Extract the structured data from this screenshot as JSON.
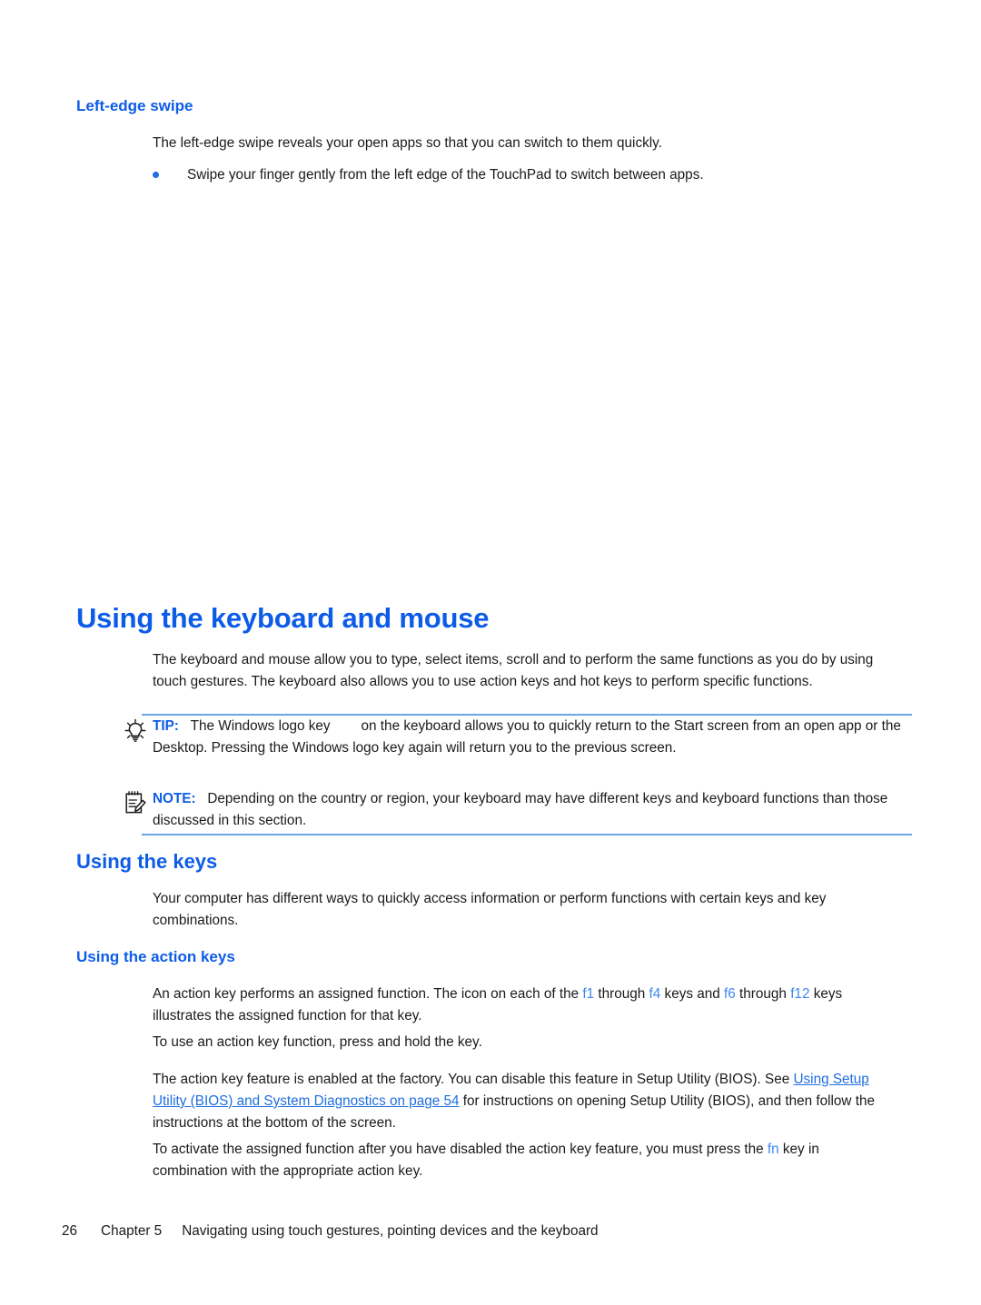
{
  "document": {
    "section_heading": "Left-edge swipe",
    "left_edge_swipe": {
      "intro": "The left-edge swipe reveals your open apps so that you can switch to them quickly.",
      "bullet": "Swipe your finger gently from the left edge of the TouchPad to switch between apps."
    },
    "keyboard_mouse": {
      "title": "Using the keyboard and mouse",
      "intro": "The keyboard and mouse allow you to type, select items, scroll and to perform the same functions as you do by using touch gestures. The keyboard also allows you to use action keys and hot keys to perform specific functions.",
      "tip": {
        "label": "TIP:",
        "icon": "lightbulb-icon",
        "text_before_key": "The Windows logo key",
        "text_after_key": "on the keyboard allows you to quickly return to the Start screen from an open app or the Desktop. Pressing the Windows logo key again will return you to the previous screen."
      },
      "note": {
        "label": "NOTE:",
        "icon": "notepad-pencil-icon",
        "text": "Depending on the country or region, your keyboard may have different keys and keyboard functions than those discussed in this section."
      }
    },
    "using_the_keys": {
      "title": "Using the keys",
      "intro": "Your computer has different ways to quickly access information or perform functions with certain keys and key combinations."
    },
    "action_keys": {
      "title": "Using the action keys",
      "para1_a": "An action key performs an assigned function. The icon on each of the ",
      "key_f1": "f1",
      "para1_b": " through ",
      "key_f4": "f4",
      "para1_c": " keys and ",
      "key_f6": "f6",
      "para1_d": " through ",
      "key_f12": "f12",
      "para1_e": " keys illustrates the assigned function for that key.",
      "para2": "To use an action key function, press and hold the key.",
      "para3_a": "The action key feature is enabled at the factory. You can disable this feature in Setup Utility (BIOS). See ",
      "para3_link": "Using Setup Utility (BIOS) and System Diagnostics on page 54",
      "para3_b": " for instructions on opening Setup Utility (BIOS), and then follow the instructions at the bottom of the screen.",
      "para4_a": "To activate the assigned function after you have disabled the action key feature, you must press the ",
      "key_fn": "fn",
      "para4_b": " key in combination with the appropriate action key."
    },
    "footer": {
      "page_number": "26",
      "chapter": "Chapter 5",
      "chapter_title": "Navigating using touch gestures, pointing devices and the keyboard"
    },
    "colors": {
      "heading_blue": "#0d5ce8",
      "link_blue": "#1f6fe0",
      "key_blue": "#3f86f0",
      "rule_blue": "#6aa6e8",
      "body_black": "#1a1a1a"
    }
  }
}
